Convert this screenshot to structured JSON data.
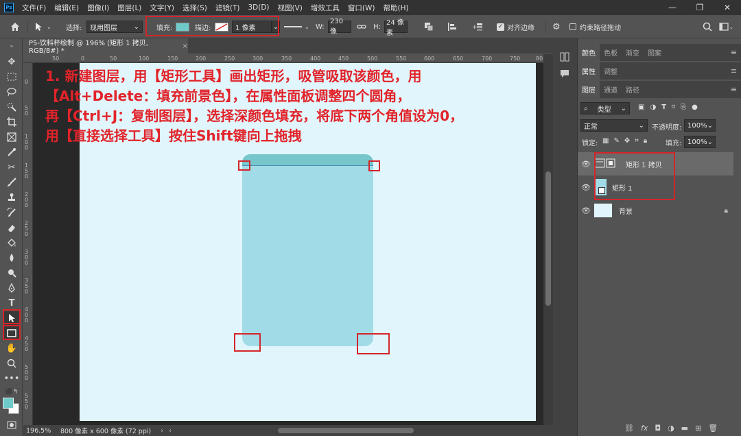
{
  "app": {
    "logo": "Ps"
  },
  "menu": [
    "文件(F)",
    "编辑(E)",
    "图像(I)",
    "图层(L)",
    "文字(Y)",
    "选择(S)",
    "滤镜(T)",
    "3D(D)",
    "视图(V)",
    "增效工具",
    "窗口(W)",
    "帮助(H)"
  ],
  "window_controls": [
    "—",
    "❐",
    "✕"
  ],
  "options": {
    "select_label": "选择:",
    "select_value": "现用图层",
    "fill_label": "填充:",
    "fill_color": "#6ecbc9",
    "stroke_label": "描边:",
    "stroke_width": "1 像素",
    "w_label": "W:",
    "w_value": "230 像",
    "h_label": "H:",
    "h_value": "24 像素",
    "align_edges_label": "对齐边缘",
    "constrain_label": "约束路径拖动"
  },
  "document": {
    "tab_title": "P5-饮料杯绘制 @ 196% (矩形 1 拷贝, RGB/8#) *",
    "zoom": "196.5%",
    "size_info": "800 像素 x 600 像素 (72 ppi)"
  },
  "ruler_h": [
    "50",
    "0",
    "50",
    "100",
    "150",
    "200",
    "250",
    "300",
    "350",
    "400",
    "450",
    "500",
    "550",
    "600",
    "650",
    "700",
    "750",
    "80"
  ],
  "ruler_v": [
    "0",
    "5\n0",
    "1\n0\n0",
    "1\n5\n0",
    "2\n0\n0",
    "2\n5\n0",
    "3\n0\n0",
    "3\n5\n0",
    "4\n0\n0",
    "4\n5\n0",
    "5\n0\n0",
    "5\n5\n0"
  ],
  "annotation": {
    "line1": "1. 新建图层，用【矩形工具】画出矩形，吸管吸取该颜色，用",
    "line2": "【Alt+Delete：填充前景色】，在属性面板调整四个圆角，",
    "line3": "再【Ctrl+J：复制图层】，选择深颜色填充，将底下两个角值设为0，",
    "line4": "用【直接选择工具】按住Shift键向上拖拽"
  },
  "panels": {
    "tabs_top": [
      "颜色",
      "色板",
      "渐变",
      "图案"
    ],
    "tabs_mid": [
      "属性",
      "调整"
    ],
    "tabs_layers": [
      "图层",
      "通道",
      "路径"
    ],
    "filter_kind": "类型",
    "blend_mode": "正常",
    "opacity_label": "不透明度:",
    "opacity_value": "100%",
    "lock_label": "锁定:",
    "fill_label": "填充:",
    "fill_value": "100%"
  },
  "layers": [
    {
      "name": "矩形 1 拷贝"
    },
    {
      "name": "矩形 1"
    },
    {
      "name": "背景"
    }
  ],
  "colors": {
    "canvas": "#e0f6fc",
    "rect_body": "#a2dbe8",
    "rect_top": "#76c6cc",
    "annotation": "#e2232a",
    "foreground": "#6ecbc9"
  }
}
